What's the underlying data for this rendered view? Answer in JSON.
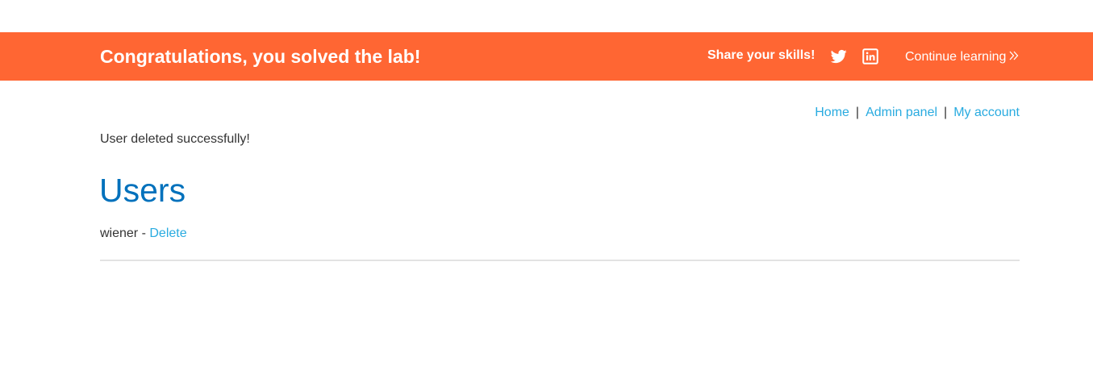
{
  "banner": {
    "title": "Congratulations, you solved the lab!",
    "share_label": "Share your skills!",
    "twitter_icon": "twitter-icon",
    "linkedin_icon": "linkedin-icon",
    "continue_label": "Continue learning",
    "continue_icon": "double-chevron-right-icon",
    "background_color": "#ff6633"
  },
  "nav": {
    "home": "Home",
    "separator": "|",
    "admin_panel": "Admin panel",
    "my_account": "My account",
    "link_color": "#29abe0"
  },
  "status": {
    "message": "User deleted successfully!"
  },
  "main": {
    "heading": "Users",
    "heading_color": "#0071bc",
    "users": [
      {
        "name": "wiener",
        "separator": "-",
        "action": "Delete"
      }
    ]
  }
}
